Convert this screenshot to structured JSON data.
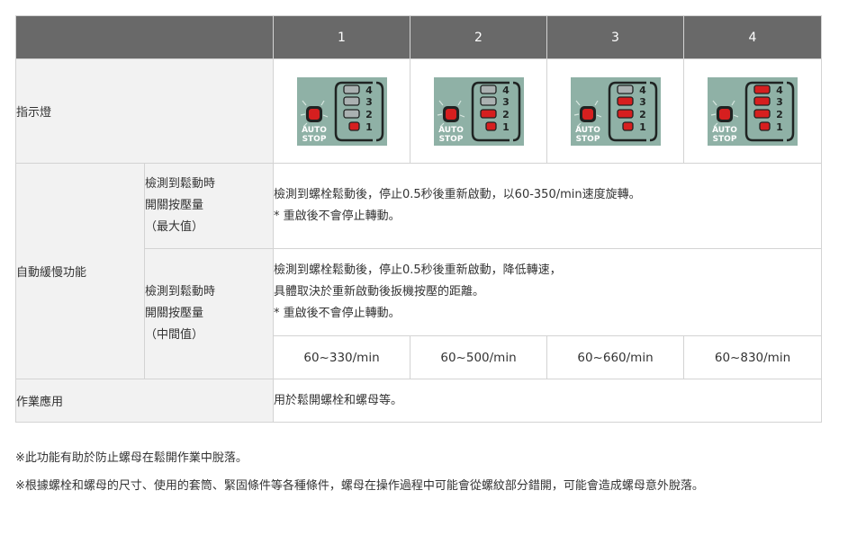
{
  "header": {
    "col1": "1",
    "col2": "2",
    "col3": "3",
    "col4": "4"
  },
  "indicator": {
    "label": "指示燈",
    "auto_label": "AUTO",
    "stop_label": "STOP",
    "levels": [
      "1",
      "2",
      "3",
      "4"
    ],
    "lit_counts": [
      1,
      2,
      3,
      4
    ],
    "colors": {
      "lit": "#d61f1f",
      "unlit": "#aab1b1",
      "panel": "#8fb1a6",
      "dark": "#1f2322"
    }
  },
  "auto_slow": {
    "label": "自動緩慢功能",
    "max": {
      "label_lines": [
        "檢測到鬆動時",
        "開關按壓量",
        "（最大值）"
      ],
      "desc_lines": [
        "檢測到螺栓鬆動後，停止0.5秒後重新啟動，以60-350/min速度旋轉。",
        "* 重啟後不會停止轉動。"
      ]
    },
    "mid": {
      "label_lines": [
        "檢測到鬆動時",
        "開關按壓量",
        "（中間值）"
      ],
      "desc_lines": [
        "檢測到螺栓鬆動後，停止0.5秒後重新啟動，降低轉速，",
        "具體取決於重新啟動後扳機按壓的距離。",
        "* 重啟後不會停止轉動。"
      ],
      "speeds": [
        "60~330/min",
        "60~500/min",
        "60~660/min",
        "60~830/min"
      ]
    }
  },
  "application": {
    "label": "作業應用",
    "desc": "用於鬆開螺栓和螺母等。"
  },
  "notes": [
    "※此功能有助於防止螺母在鬆開作業中脫落。",
    "※根據螺栓和螺母的尺寸、使用的套筒、緊固條件等各種條件，螺母在操作過程中可能會從螺紋部分錯開，可能會造成螺母意外脫落。"
  ]
}
